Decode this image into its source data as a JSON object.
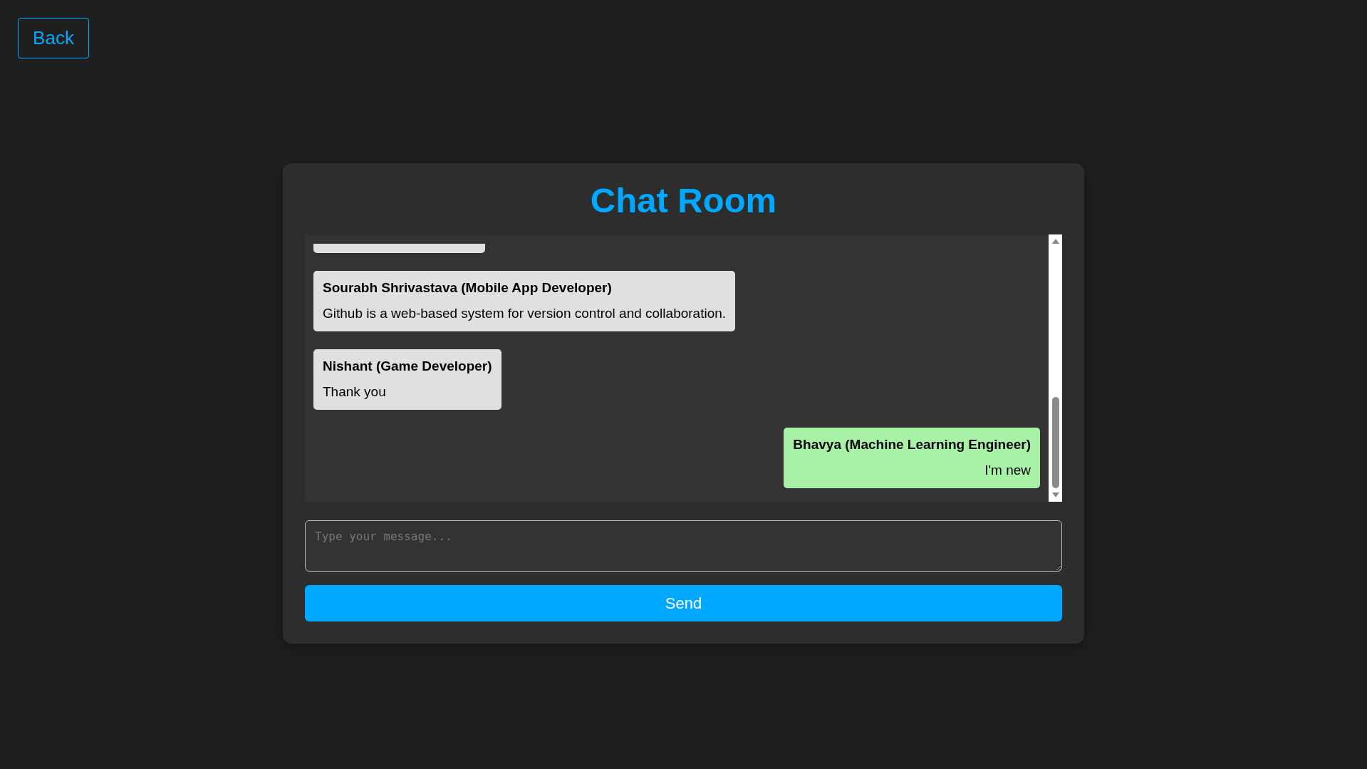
{
  "back_button": "Back",
  "title": "Chat Room",
  "messages": [
    {
      "sender": "Sourabh Shrivastava (Mobile App Developer)",
      "text": "Github is a web-based system for version control and collaboration.",
      "own": false
    },
    {
      "sender": "Nishant (Game Developer)",
      "text": "Thank you",
      "own": false
    },
    {
      "sender": "Bhavya (Machine Learning Engineer)",
      "text": "I'm new",
      "own": true
    }
  ],
  "message_input": {
    "placeholder": "Type your message..."
  },
  "send_button": "Send"
}
